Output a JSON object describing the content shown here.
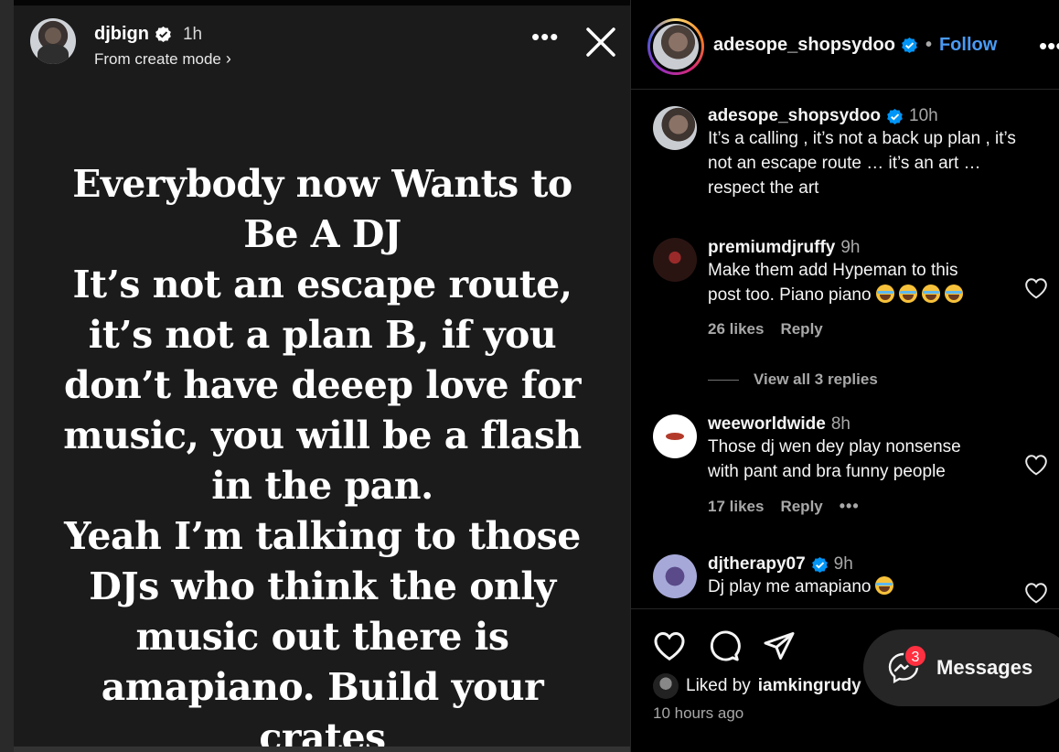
{
  "story": {
    "username": "djbign",
    "time": "1h",
    "subtitle": "From create mode",
    "lines": [
      "Everybody now Wants to",
      "Be A DJ",
      "It’s not an escape route,",
      "it’s not a plan B, if you",
      "don’t have deeep love for",
      "music, you will be a flash",
      "in the pan.",
      "Yeah I’m talking to those",
      "DJs who think the only",
      "music out there is",
      "amapiano. Build your",
      "crates"
    ]
  },
  "post": {
    "username": "adesope_shopsydoo",
    "dot": "•",
    "follow_label": "Follow",
    "liked_by_prefix": "Liked by",
    "liked_by_user": "iamkingrudy",
    "age": "10 hours ago"
  },
  "comments": [
    {
      "user": "adesope_shopsydoo",
      "time": "10h",
      "verified": true,
      "lines": [
        "It’s a calling , it’s not a back up plan , it’s",
        "not an escape route … it’s an art …",
        "respect the art"
      ]
    },
    {
      "user": "premiumdjruffy",
      "time": "9h",
      "verified": false,
      "lines": [
        "Make them add Hypeman to this",
        "post too. Piano piano"
      ],
      "emoji_count": 4,
      "likes": "26 likes",
      "reply_label": "Reply",
      "view_replies": "View all 3 replies"
    },
    {
      "user": "weeworldwide",
      "time": "8h",
      "verified": false,
      "lines": [
        "Those dj wen dey play nonsense",
        "with pant and bra funny people"
      ],
      "likes": "17 likes",
      "reply_label": "Reply",
      "more": "•••"
    },
    {
      "user": "djtherapy07",
      "time": "9h",
      "verified": true,
      "lines": [
        "Dj play me amapiano"
      ],
      "emoji_count": 1
    }
  ],
  "messages": {
    "label": "Messages",
    "badge": "3"
  },
  "colors": {
    "verified": "#0095f6",
    "follow": "#4a9bf5",
    "badge": "#ff3040"
  },
  "icons": [
    "verified-badge-icon",
    "close-icon",
    "more-icon",
    "heart-icon",
    "comment-icon",
    "share-icon",
    "messenger-icon",
    "chevron-right-icon",
    "laughing-emoji-icon"
  ]
}
